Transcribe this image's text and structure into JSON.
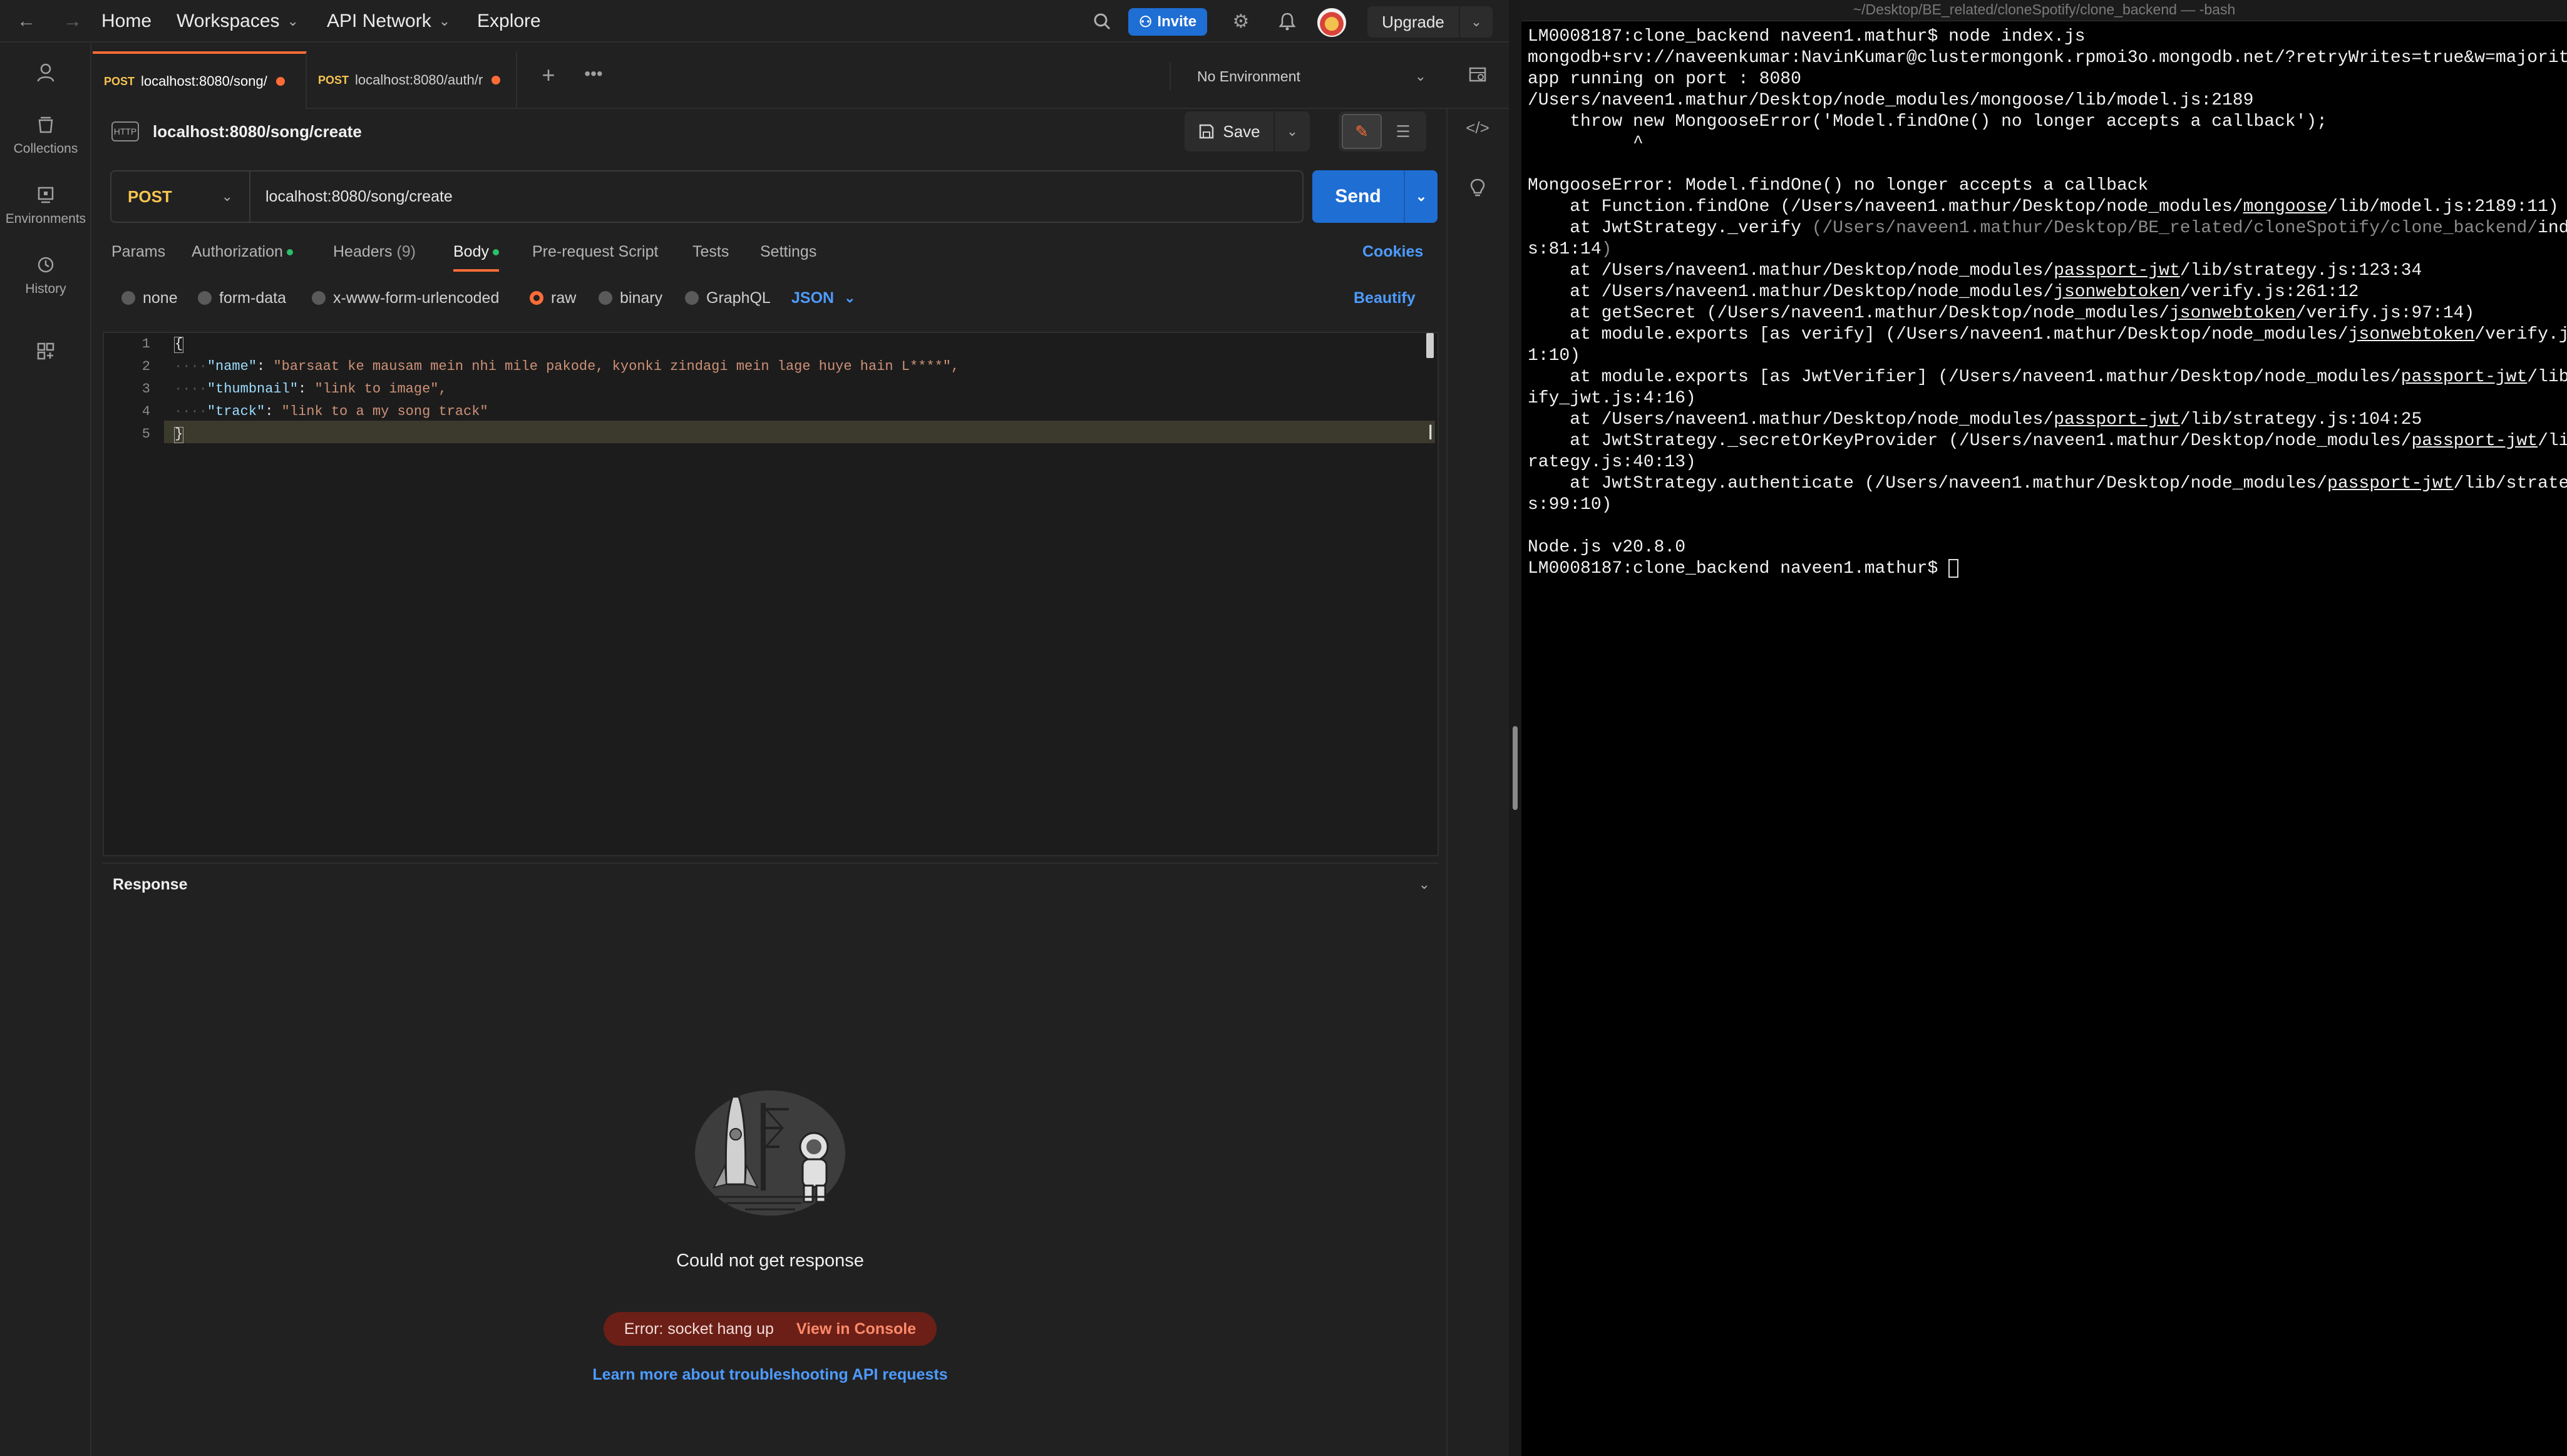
{
  "topbar": {
    "home": "Home",
    "workspaces": "Workspaces",
    "api_network": "API Network",
    "explore": "Explore",
    "invite": "Invite",
    "upgrade": "Upgrade"
  },
  "sidebar": {
    "items": [
      {
        "label": "",
        "icon": "user-icon"
      },
      {
        "label": "Collections",
        "icon": "collections-icon"
      },
      {
        "label": "Environments",
        "icon": "environments-icon"
      },
      {
        "label": "History",
        "icon": "history-icon"
      },
      {
        "label": "",
        "icon": "apps-icon"
      }
    ]
  },
  "tabs": [
    {
      "method": "POST",
      "label": "localhost:8080/song/"
    },
    {
      "method": "POST",
      "label": "localhost:8080/auth/r"
    }
  ],
  "environment": "No Environment",
  "request": {
    "title": "localhost:8080/song/create",
    "save": "Save",
    "method": "POST",
    "url": "localhost:8080/song/create",
    "send": "Send",
    "tabs": [
      "Params",
      "Authorization",
      "Headers",
      "Body",
      "Pre-request Script",
      "Tests",
      "Settings"
    ],
    "headers_count": "(9)",
    "cookies": "Cookies",
    "body_types": [
      "none",
      "form-data",
      "x-www-form-urlencoded",
      "raw",
      "binary",
      "GraphQL"
    ],
    "body_format": "JSON",
    "beautify": "Beautify",
    "body_lines": [
      {
        "num": "1",
        "text": "{"
      },
      {
        "num": "2",
        "key": "\"name\"",
        "value": "\"barsaat ke mausam mein nhi mile pakode, kyonki zindagi mein lage huye hain L****\","
      },
      {
        "num": "3",
        "key": "\"thumbnail\"",
        "value": "\"link to image\","
      },
      {
        "num": "4",
        "key": "\"track\"",
        "value": "\"link to a my song track\""
      },
      {
        "num": "5",
        "text": "}"
      }
    ]
  },
  "response": {
    "title": "Response",
    "message": "Could not get response",
    "error": "Error: socket hang up",
    "view_console": "View in Console",
    "learn_more": "Learn more about troubleshooting API requests"
  },
  "terminal": {
    "title": "~/Desktop/BE_related/cloneSpotify/clone_backend — -bash",
    "prompt_cmd": "LM0008187:clone_backend naveen1.mathur$ node index.js",
    "mongo_url": "mongodb+srv://naveenkumar:NavinKumar@clustermongonk.rpmoi3o.mongodb.net/?retryWrites=true&w=majority",
    "app_running": "app running on port : 8080",
    "err_file": "/Users/naveen1.mathur/Desktop/node_modules/mongoose/lib/model.js:2189",
    "throw_line": "    throw new MongooseError('Model.findOne() no longer accepts a callback');",
    "caret": "          ^",
    "error_msg": "MongooseError: Model.findOne() no longer accepts a callback",
    "node_version": "Node.js v20.8.0",
    "final_prompt": "LM0008187:clone_backend naveen1.mathur$ "
  },
  "colors": {
    "accent": "#ff6c37",
    "primary_blue": "#1f6ed4",
    "method_yellow": "#f5c451",
    "error_bg": "#6b1f17"
  }
}
